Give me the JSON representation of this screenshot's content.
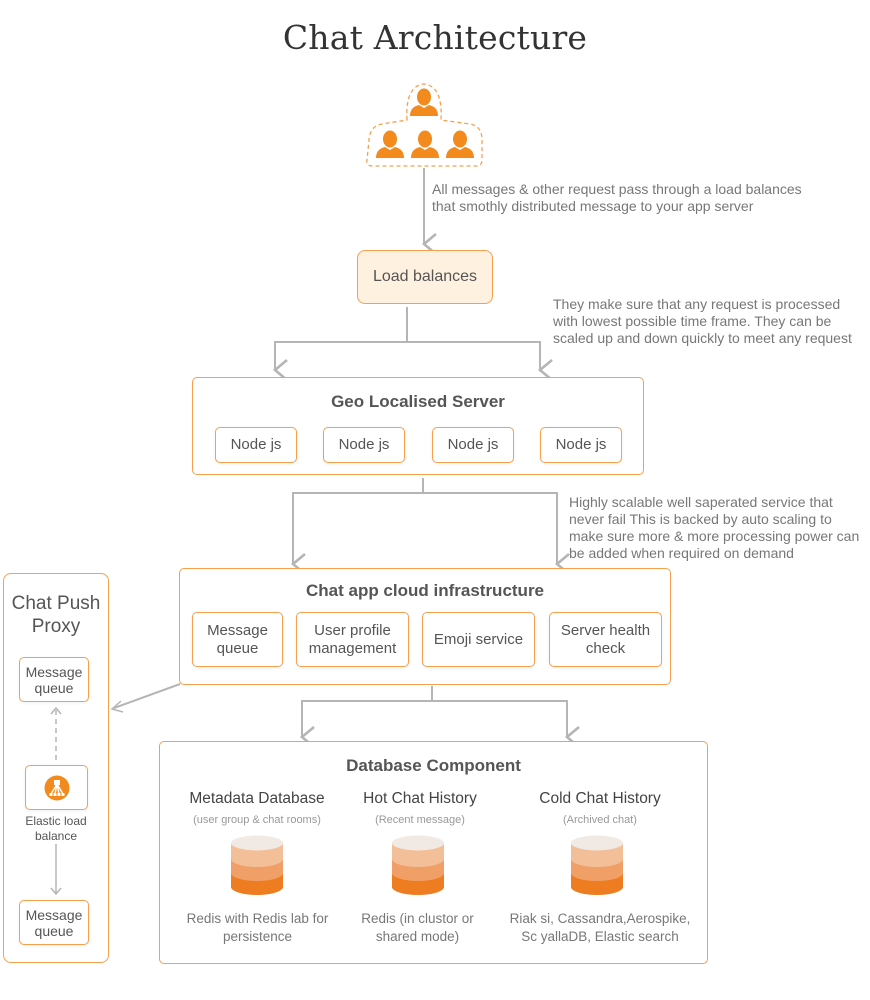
{
  "title": "Chat Architecture",
  "users_icon": "users-group-icon",
  "notes": {
    "users_to_lb": "All messages & other request  pass through a load balances that smothly distributed message to your app server",
    "lb_to_geo": "They make sure that any request is processed with lowest possible time frame. They can be scaled up and  down quickly to meet any request",
    "geo_to_cloud": "Highly scalable well saperated service that never fail This is backed by auto scaling to make sure more & more processing power can be added when required on demand"
  },
  "load_balancer": {
    "label": "Load balances"
  },
  "geo_server": {
    "title": "Geo Localised Server",
    "nodes": [
      "Node js",
      "Node js",
      "Node js",
      "Node js"
    ]
  },
  "cloud_infra": {
    "title": "Chat app cloud infrastructure",
    "services": [
      "Message queue",
      "User profile management",
      "Emoji service",
      "Server health check"
    ]
  },
  "push_proxy": {
    "title": "Chat Push Proxy",
    "top_queue": "Message queue",
    "elb_icon": "elastic-load-balancer-icon",
    "elb_label": "Elastic load balance",
    "bottom_queue": "Message queue"
  },
  "database": {
    "title": "Database Component",
    "columns": [
      {
        "name": "Metadata Database",
        "sub": "(user group & chat rooms)",
        "tech": "Redis with Redis lab for persistence",
        "icon": "database-icon"
      },
      {
        "name": "Hot Chat History",
        "sub": "(Recent message)",
        "tech": "Redis (in clustor or shared mode)",
        "icon": "database-icon"
      },
      {
        "name": "Cold Chat History",
        "sub": "(Archived chat)",
        "tech": "Riak si, Cassandra,Aerospike, Sc yallaDB, Elastic search",
        "icon": "database-icon"
      }
    ]
  },
  "colors": {
    "accent": "#f6a04d",
    "icon_orange": "#f28a1e",
    "lb_fill": "#fff1e0",
    "connector": "#b5b5b5",
    "text": "#555555"
  }
}
